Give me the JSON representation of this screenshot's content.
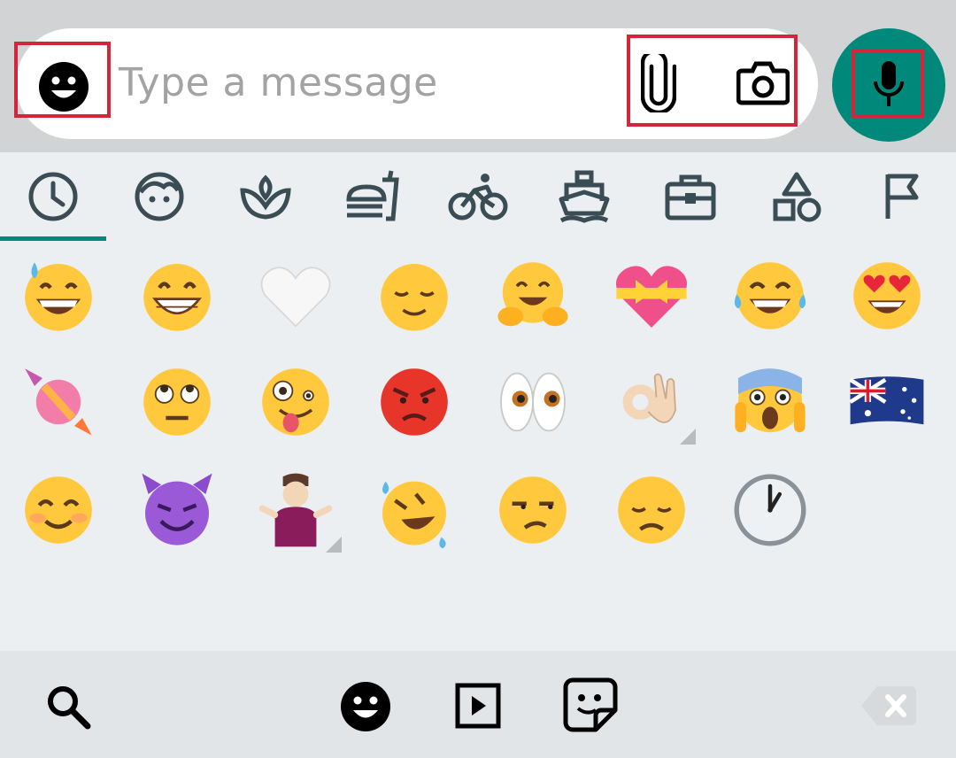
{
  "composer": {
    "placeholder": "Type a message",
    "emoji_button_icon": "smiley-face-icon",
    "attach_icon": "paperclip-icon",
    "camera_icon": "camera-icon",
    "mic_icon": "microphone-icon"
  },
  "category_tabs": [
    {
      "icon": "recent-clock-icon",
      "selected": true
    },
    {
      "icon": "smileys-people-icon",
      "selected": false
    },
    {
      "icon": "animals-nature-icon",
      "selected": false
    },
    {
      "icon": "food-drink-icon",
      "selected": false
    },
    {
      "icon": "activity-icon",
      "selected": false
    },
    {
      "icon": "travel-places-icon",
      "selected": false
    },
    {
      "icon": "objects-icon",
      "selected": false
    },
    {
      "icon": "symbols-icon",
      "selected": false
    },
    {
      "icon": "flags-icon",
      "selected": false
    }
  ],
  "recent_emojis": [
    [
      "grinning-face-with-sweat",
      "beaming-face",
      "white-heart",
      "relieved-face",
      "hugging-face",
      "heart-with-ribbon",
      "face-with-tears-of-joy",
      "smiling-face-with-heart-eyes"
    ],
    [
      "candy",
      "face-with-rolling-eyes",
      "zany-face",
      "pouting-face",
      "eyes",
      "ok-hand",
      "face-screaming-in-fear",
      "flag-australia"
    ],
    [
      "smiling-face-with-smiling-eyes",
      "smiling-face-with-horns",
      "person-shrugging",
      "rolling-on-the-floor-laughing",
      "unamused-face",
      "disappointed-face",
      "one-oclock"
    ]
  ],
  "bottom_bar": {
    "search_icon": "search-icon",
    "emoji_tab_icon": "smiley-face-icon",
    "gif_tab_icon": "gif-play-icon",
    "sticker_tab_icon": "sticker-icon",
    "backspace_icon": "backspace-icon"
  },
  "colors": {
    "accent": "#00897b",
    "highlight": "#d3263a",
    "icon_gray": "#3b4d54",
    "top_bar": "#d1d3d4",
    "panel": "#eceff1"
  }
}
